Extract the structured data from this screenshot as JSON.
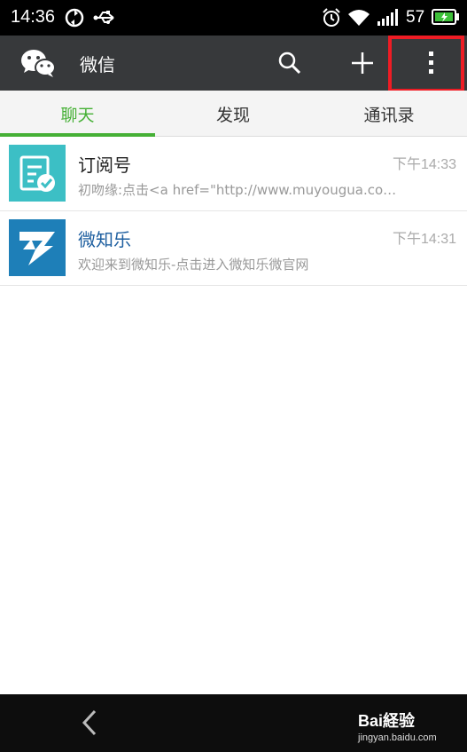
{
  "status_bar": {
    "time": "14:36",
    "battery_percent": "57",
    "icons": [
      "sync-icon",
      "usb-icon",
      "alarm-icon",
      "wifi-icon",
      "signal-icon",
      "battery-icon"
    ]
  },
  "app_bar": {
    "title": "微信",
    "icons": [
      "wechat-logo-icon",
      "search-icon",
      "plus-icon",
      "more-vert-icon"
    ],
    "highlight_color": "#ee1c24"
  },
  "tabs": [
    {
      "label": "聊天",
      "active": true
    },
    {
      "label": "发现",
      "active": false
    },
    {
      "label": "通讯录",
      "active": false
    }
  ],
  "chats": [
    {
      "name": "订阅号",
      "time": "下午14:33",
      "preview": "初吻缘:点击<a href=\"http://www.muyougua.com\">",
      "avatar": "subscription-icon",
      "avatar_color": "#3cbfc5"
    },
    {
      "name": "微知乐",
      "time": "下午14:31",
      "preview": "欢迎来到微知乐-点击进入微知乐微官网",
      "avatar": "weizhile-logo-icon",
      "avatar_color": "#1e7fb8"
    }
  ],
  "nav_bar": {
    "back_icon": "back-arrow-icon",
    "watermark_brand": "Bai経验",
    "watermark_url": "jingyan.baidu.com"
  },
  "colors": {
    "accent": "#45b035",
    "app_bar": "#37393b"
  }
}
